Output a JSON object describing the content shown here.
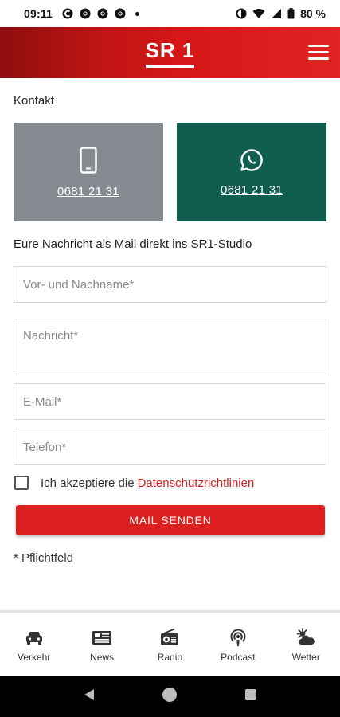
{
  "status_bar": {
    "time": "09:11",
    "battery": "80 %"
  },
  "app_bar": {
    "logo": "SR 1",
    "menu_icon": "hamburger-icon"
  },
  "contact": {
    "title": "Kontakt",
    "phone_tile": {
      "icon": "smartphone-icon",
      "number": "0681 21 31"
    },
    "whatsapp_tile": {
      "icon": "whatsapp-icon",
      "number": "0681 21 31"
    }
  },
  "form": {
    "subtitle": "Eure Nachricht als Mail direkt ins SR1-Studio",
    "name_placeholder": "Vor- und Nachname*",
    "message_placeholder": "Nachricht*",
    "email_placeholder": "E-Mail*",
    "phone_placeholder": "Telefon*",
    "consent_text": "Ich akzeptiere die",
    "consent_link": "Datenschutzrichtlinien",
    "submit_label": "MAIL SENDEN",
    "required_note": "* Pflichtfeld"
  },
  "bottom_nav": [
    {
      "label": "Verkehr",
      "icon": "car-icon"
    },
    {
      "label": "News",
      "icon": "newspaper-icon"
    },
    {
      "label": "Radio",
      "icon": "radio-icon"
    },
    {
      "label": "Podcast",
      "icon": "podcast-icon"
    },
    {
      "label": "Wetter",
      "icon": "weather-icon"
    }
  ],
  "colors": {
    "brand_red": "#dc1f1f",
    "phone_tile": "#858b91",
    "whatsapp_tile": "#0f5e50",
    "link": "#d42222"
  }
}
